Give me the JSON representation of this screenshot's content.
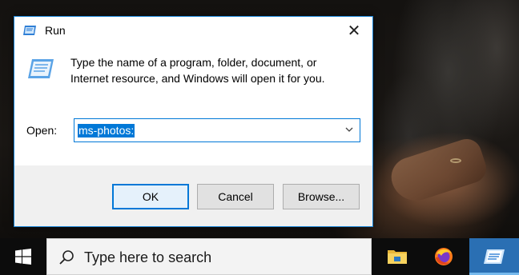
{
  "window": {
    "title": "Run",
    "close_glyph": "✕",
    "icon": "run-icon"
  },
  "dialog": {
    "description": "Type the name of a program, folder, document, or Internet resource, and Windows will open it for you.",
    "open_label": "Open:",
    "open_value": "ms-photos:",
    "buttons": {
      "ok": "OK",
      "cancel": "Cancel",
      "browse": "Browse..."
    }
  },
  "taskbar": {
    "search_placeholder": "Type here to search",
    "icons": [
      "windows-start-icon",
      "search-icon",
      "file-explorer-icon",
      "firefox-icon",
      "run-icon"
    ]
  },
  "colors": {
    "accent": "#0078d7",
    "taskbar": "#0c0c0c",
    "dialog_bg": "#f0f0f0"
  }
}
